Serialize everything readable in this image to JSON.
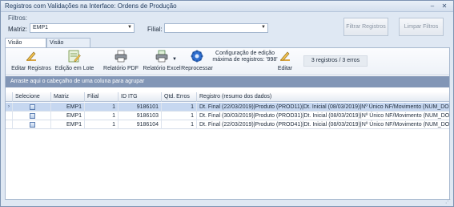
{
  "window": {
    "title": "Registros com Validações na Interface: Ordens de Produção",
    "minimize_glyph": "–",
    "close_glyph": "✕"
  },
  "filters": {
    "title": "Filtros:",
    "matriz_label": "Matriz:",
    "matriz_value": "EMP1",
    "filial_label": "Filial:",
    "filial_value": "",
    "filter_button": "Filtrar Registros",
    "clear_button": "Limpar Filtros"
  },
  "tabs": [
    {
      "label": "Visão Agrupada",
      "active": true
    },
    {
      "label": "Visão Detalhada",
      "active": false
    }
  ],
  "toolbar": {
    "edit_records": "Editar Registros",
    "batch_edit": "Edição em Lote",
    "pdf_report": "Relatório PDF",
    "excel_report": "Relatório Excel",
    "reprocess": "Reprocessar",
    "config_text": "Configuração de edição máxima de registros: '998'",
    "edit": "Editar",
    "status": "3 registros / 3 erros"
  },
  "grid": {
    "group_hint": "Arraste aqui o cabeçalho de uma coluna para agrupar",
    "columns": [
      "Selecione",
      "Matriz",
      "Filial",
      "ID ITG",
      "Qtd. Erros",
      "Registro (resumo dos dados)"
    ],
    "rows": [
      {
        "matriz": "EMP1",
        "filial": "1",
        "id_itg": "9186101",
        "qtd_erros": "1",
        "registro": "Dt. Final (22/03/2019)|Produto (PROD11)|Dt. Inicial (08/03/2019)|Nº Único NF/Movimento (NUM_DOC_ERP)|",
        "selected": true
      },
      {
        "matriz": "EMP1",
        "filial": "1",
        "id_itg": "9186103",
        "qtd_erros": "1",
        "registro": "Dt. Final (30/03/2019)|Produto (PROD31)|Dt. Inicial (08/03/2019)|Nº Único NF/Movimento (NUM_DOC_ERP)|",
        "selected": false
      },
      {
        "matriz": "EMP1",
        "filial": "1",
        "id_itg": "9186104",
        "qtd_erros": "1",
        "registro": "Dt. Final (22/03/2019)|Produto (PROD41)|Dt. Inicial (08/03/2019)|Nº Único NF/Movimento (NUM_DOC_ERP)|",
        "selected": false
      }
    ]
  },
  "colors": {
    "accent": "#8296b6",
    "selected_row": "#c6d7f0"
  }
}
